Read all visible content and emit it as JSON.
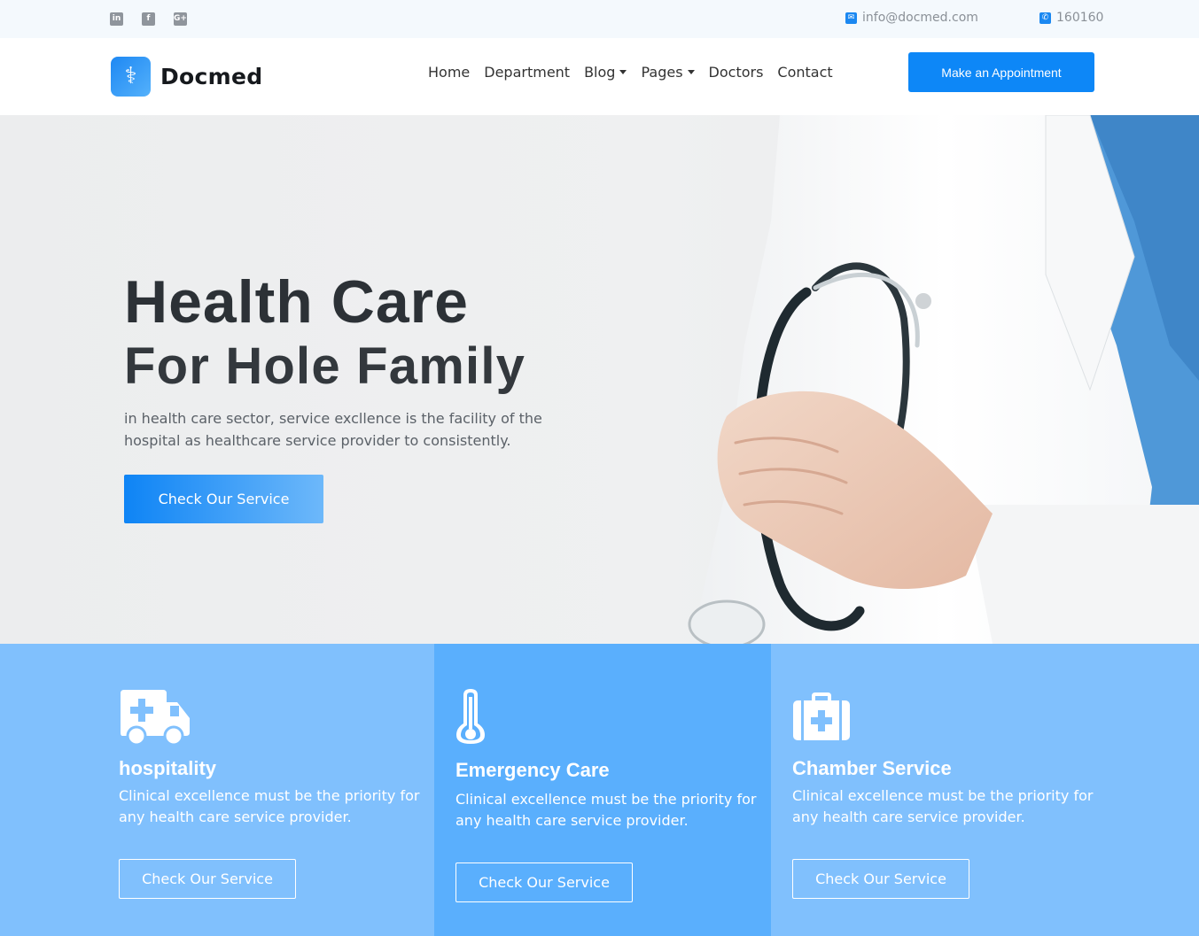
{
  "topbar": {
    "social": [
      {
        "name": "linkedin-icon",
        "glyph": "in"
      },
      {
        "name": "facebook-icon",
        "glyph": "f"
      },
      {
        "name": "google-plus-icon",
        "glyph": "G+"
      }
    ],
    "email": "info@docmed.com",
    "phone": "160160"
  },
  "header": {
    "logo_text": "Docmed",
    "nav": [
      {
        "label": "Home",
        "dropdown": false
      },
      {
        "label": "Department",
        "dropdown": false
      },
      {
        "label": "Blog",
        "dropdown": true
      },
      {
        "label": "Pages",
        "dropdown": true
      },
      {
        "label": "Doctors",
        "dropdown": false
      },
      {
        "label": "Contact",
        "dropdown": false
      }
    ],
    "cta": "Make an Appointment"
  },
  "hero": {
    "title": "Health Care",
    "subtitle": "For Hole Family",
    "description": "in health care sector, service excllence is the facility of the hospital as healthcare service provider to consistently.",
    "button": "Check Our Service"
  },
  "services": [
    {
      "icon": "ambulance-icon",
      "title": "hospitality",
      "description": "Clinical excellence must be the priority for any health care service provider.",
      "button": "Check Our Service"
    },
    {
      "icon": "thermometer-icon",
      "title": "Emergency Care",
      "description": "Clinical excellence must be the priority for any health care service provider.",
      "button": "Check Our Service"
    },
    {
      "icon": "first-aid-kit-icon",
      "title": "Chamber Service",
      "description": "Clinical excellence must be the priority for any health care service provider.",
      "button": "Check Our Service"
    }
  ],
  "colors": {
    "accent": "#0d87f7",
    "service_light": "#80c0fd",
    "service_mid": "#5aaffd"
  }
}
